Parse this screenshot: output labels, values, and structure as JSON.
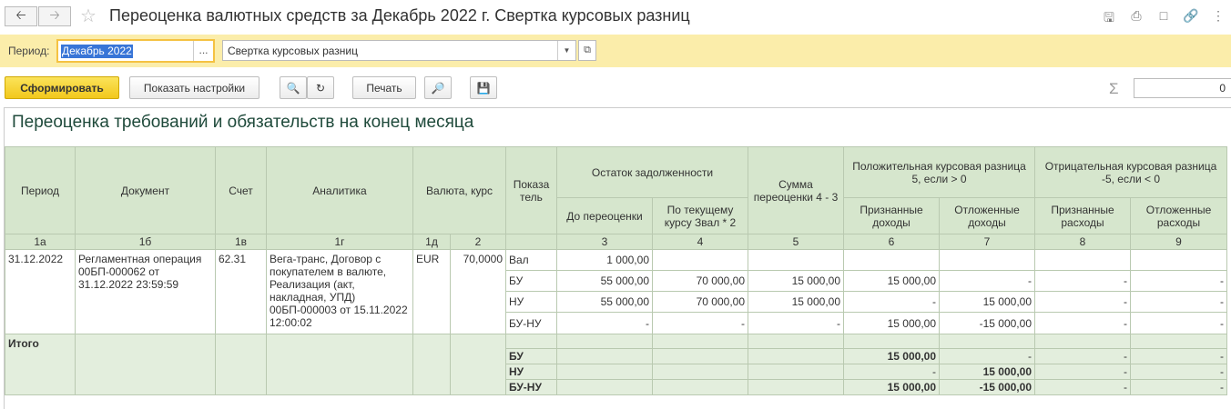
{
  "window": {
    "back_icon": "arrow-left-icon",
    "forward_icon": "arrow-right-icon",
    "title": "Переоценка валютных средств за Декабрь 2022 г. Свертка курсовых разниц",
    "icons": [
      "save-icon",
      "print-icon",
      "preview-icon",
      "link-icon",
      "more-icon"
    ]
  },
  "period_bar": {
    "period_label": "Период:",
    "period_value": "Декабрь 2022",
    "period_select": "...",
    "variant_value": "Свертка курсовых разниц"
  },
  "toolbar": {
    "generate_label": "Сформировать",
    "settings_label": "Показать настройки",
    "print_label": "Печать",
    "sum_value": "0"
  },
  "report": {
    "title": "Переоценка требований и обязательств на конец месяца",
    "headers": {
      "period": "Период",
      "document": "Документ",
      "account": "Счет",
      "analytics": "Аналитика",
      "currency": "Валюта, курс",
      "indicator": "Показа тель",
      "balance": "Остаток задолженности",
      "before": "До переоценки",
      "current_rate": "По текущему курсу Звал * 2",
      "reval_sum": "Сумма переоценки 4 - 3",
      "positive": "Положительная курсовая разница 5, если > 0",
      "negative": "Отрицательная курсовая разница -5, если < 0",
      "recognized_income": "Признанные доходы",
      "deferred_income": "Отложенные доходы",
      "recognized_expense": "Признанные расходы",
      "deferred_expense": "Отложенные расходы"
    },
    "col_numbers": [
      "1а",
      "1б",
      "1в",
      "1г",
      "1д",
      "2",
      "3",
      "4",
      "5",
      "6",
      "7",
      "8",
      "9"
    ],
    "record": {
      "period": "31.12.2022",
      "document": "Регламентная операция 00БП-000062 от 31.12.2022 23:59:59",
      "account": "62.31",
      "analytics": "Вега-транс, Договор с покупателем в валюте, Реализация (акт, накладная, УПД) 00БП-000003 от 15.11.2022 12:00:02",
      "currency": "EUR",
      "rate": "70,0000",
      "rows": [
        {
          "ind": "Вал",
          "c3": "1 000,00",
          "c4": "",
          "c5": "",
          "c6": "",
          "c7": "",
          "c8": "",
          "c9": ""
        },
        {
          "ind": "БУ",
          "c3": "55 000,00",
          "c4": "70 000,00",
          "c5": "15 000,00",
          "c6": "15 000,00",
          "c7": "-",
          "c8": "-",
          "c9": "-"
        },
        {
          "ind": "НУ",
          "c3": "55 000,00",
          "c4": "70 000,00",
          "c5": "15 000,00",
          "c6": "-",
          "c7": "15 000,00",
          "c8": "-",
          "c9": "-"
        },
        {
          "ind": "БУ-НУ",
          "c3": "-",
          "c4": "-",
          "c5": "-",
          "c6": "15 000,00",
          "c7": "-15 000,00",
          "c8": "-",
          "c9": "-"
        }
      ]
    },
    "total": {
      "label": "Итого",
      "rows": [
        {
          "ind": "БУ",
          "c6": "15 000,00",
          "c7": "-",
          "c8": "-",
          "c9": "-"
        },
        {
          "ind": "НУ",
          "c6": "-",
          "c7": "15 000,00",
          "c8": "-",
          "c9": "-"
        },
        {
          "ind": "БУ-НУ",
          "c6": "15 000,00",
          "c7": "-15 000,00",
          "c8": "-",
          "c9": "-"
        }
      ]
    }
  }
}
